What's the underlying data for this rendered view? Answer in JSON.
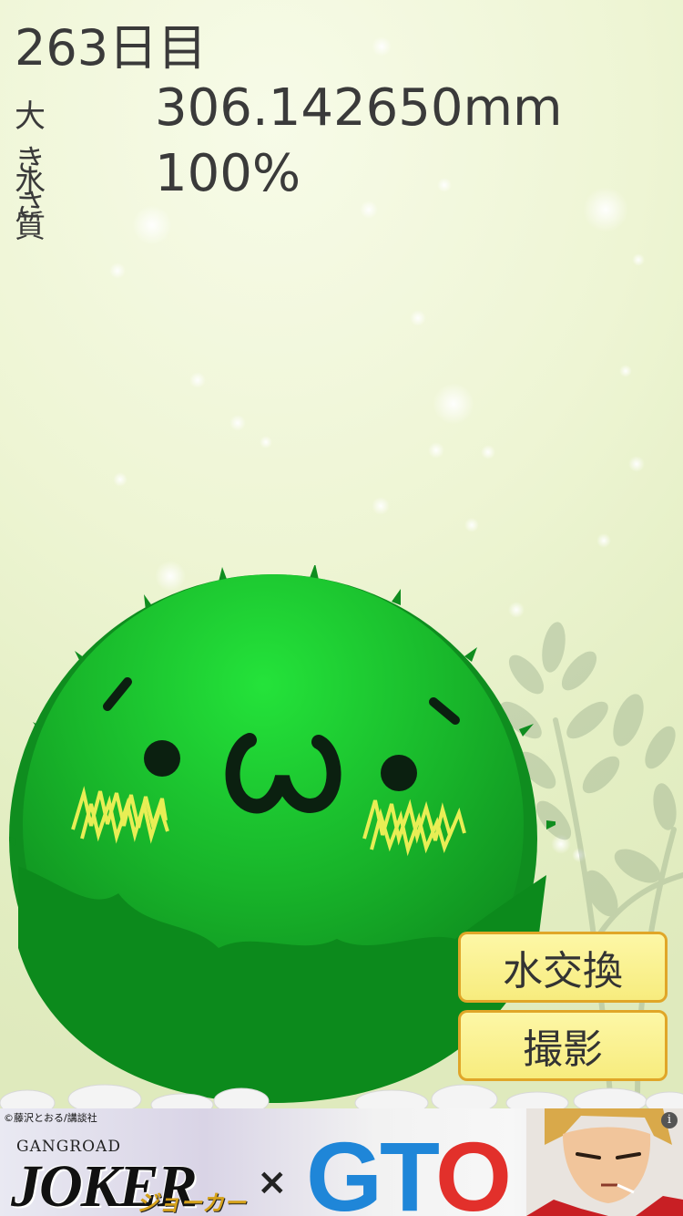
{
  "hud": {
    "day": "263日目",
    "size_label": "大きさ",
    "size_value": "306.142650mm",
    "quality_label": "水質",
    "quality_value": "100%"
  },
  "buttons": {
    "water_change": "水交換",
    "photo": "撮影"
  },
  "marimo": {
    "face_text": "´・ω・`",
    "color": "#1fc22f"
  },
  "ad": {
    "copyright": "©藤沢とおる/講談社",
    "gangroad": "GANGROAD",
    "joker": "JOKER",
    "joker_kana": "ジョーカー",
    "cross": "×",
    "gto": [
      "G",
      "T",
      "O"
    ],
    "info": "i"
  }
}
